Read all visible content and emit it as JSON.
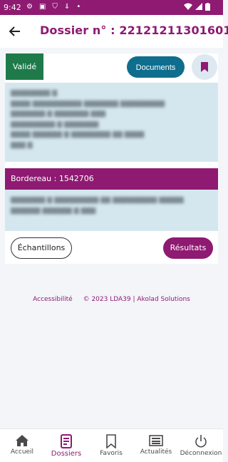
{
  "status_bar": {
    "time": "9:42",
    "left_icons": [
      "gear-icon",
      "a-icon",
      "shield-icon",
      "usb-icon",
      "dot-icon"
    ],
    "right_icons": [
      "wifi-icon",
      "signal-icon",
      "battery-icon"
    ]
  },
  "header": {
    "title": "Dossier n° : 22121211301601"
  },
  "card": {
    "status": "Validé",
    "documents_label": "Documents",
    "bordereau_label": "Bordereau : 1542706",
    "samples_label": "Échantillons",
    "results_label": "Résultats"
  },
  "footer": {
    "accessibility": "Accessibilité",
    "copyright": "© 2023 LDA39 | Akolad Solutions"
  },
  "bottom_nav": [
    {
      "label": "Accueil",
      "icon": "home-icon"
    },
    {
      "label": "Dossiers",
      "icon": "folder-icon"
    },
    {
      "label": "Favoris",
      "icon": "bookmark-icon"
    },
    {
      "label": "Actualités",
      "icon": "news-icon"
    },
    {
      "label": "Déconnexion",
      "icon": "power-icon"
    }
  ],
  "colors": {
    "brand": "#8e1a72",
    "teal": "#0f6e8e",
    "validated": "#1f7a4a",
    "info_bg": "#d5e7ee"
  }
}
